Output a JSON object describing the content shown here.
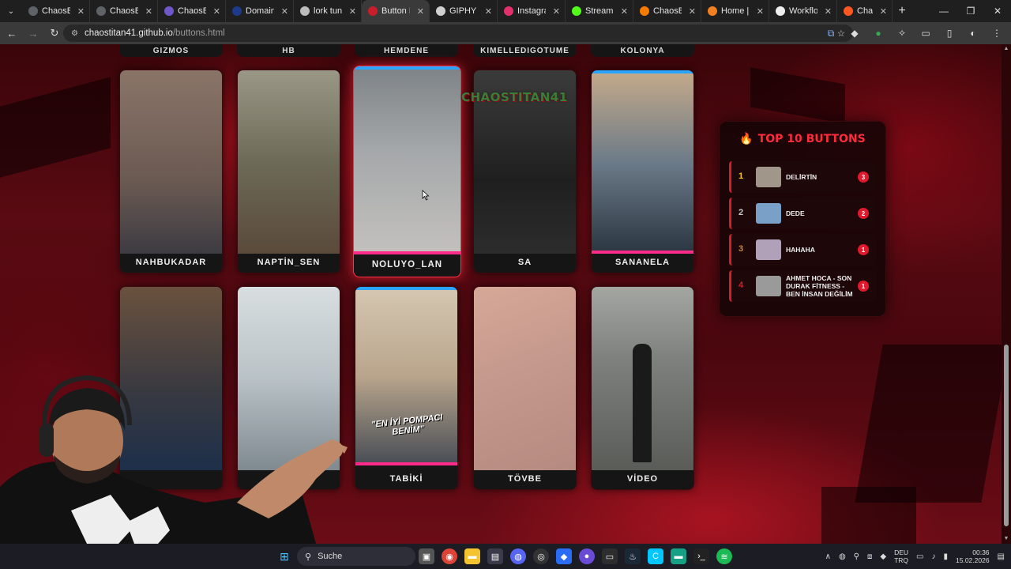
{
  "browser": {
    "tabs": [
      {
        "title": "ChaosBOT",
        "color": "#5f6368"
      },
      {
        "title": "ChaosBOT",
        "color": "#5f6368"
      },
      {
        "title": "ChaosBOT",
        "color": "#6e57c8"
      },
      {
        "title": "Domains -",
        "color": "#1e3a8a"
      },
      {
        "title": "lork tunne",
        "color": "#bdbdbd"
      },
      {
        "title": "Button Pa",
        "color": "#c81e2b"
      },
      {
        "title": "GIPHY - Be",
        "color": "#cfcfcf"
      },
      {
        "title": "Instagram",
        "color": "#e1306c"
      },
      {
        "title": "Stream - K",
        "color": "#53fc18"
      },
      {
        "title": "ChaosBot",
        "color": "#f57c00"
      },
      {
        "title": "Home | Cl",
        "color": "#f38020"
      },
      {
        "title": "Workflow",
        "color": "#eeeeee"
      },
      {
        "title": "ChaosTita",
        "color": "#ff5722"
      }
    ],
    "active_tab": 5,
    "url_host": "chaostitan41.github.io",
    "url_path": "/buttons.html"
  },
  "top_row_labels": [
    "GIZMOS",
    "HB",
    "HEMDENE",
    "KIMELLEDIGOTUME",
    "KOLONYA"
  ],
  "cards_row1": [
    {
      "label": "NAHBUKADAR",
      "bg": "#8a7468"
    },
    {
      "label": "NAPTİN_SEN",
      "bg": "#7d7a66"
    },
    {
      "label": "NOLUYO_LAN",
      "bg": "#9aa0a4"
    },
    {
      "label": "SA",
      "bg": "#2a2a2a"
    },
    {
      "label": "SANANELA",
      "bg": "#6b7a88"
    }
  ],
  "cards_row2": [
    {
      "label": "",
      "bg": "#5b4636"
    },
    {
      "label": "",
      "bg": "#b9c2c6"
    },
    {
      "label": "TABİKİ",
      "bg": "#c9b9a2"
    },
    {
      "label": "TÖVBE",
      "bg": "#c79a8e"
    },
    {
      "label": "VİDEO",
      "bg": "#8d9190"
    }
  ],
  "overlay": {
    "text": "CHAOSTITAN41"
  },
  "thumb_text": {
    "tabiki": "\"EN İYİ POMPACI BENİM\""
  },
  "top10": {
    "title": "TOP 10 BUTTONS",
    "items": [
      {
        "rank": "1",
        "name": "DELİRTİN",
        "count": "3",
        "rank_color": "#f5c518",
        "thumb": "#a0968a"
      },
      {
        "rank": "2",
        "name": "DEDE",
        "count": "2",
        "rank_color": "#c8c8c8",
        "thumb": "#7aa0c8"
      },
      {
        "rank": "3",
        "name": "HAHAHA",
        "count": "1",
        "rank_color": "#c88a3a",
        "thumb": "#b0a0b8"
      },
      {
        "rank": "4",
        "name": "AHMET HOCA - SON DURAK FİTNESS - BEN İNSAN DEĞİLİM",
        "count": "1",
        "rank_color": "#d41d2d",
        "thumb": "#9a9a9a"
      }
    ]
  },
  "taskbar": {
    "search_label": "Suche",
    "lang_top": "DEU",
    "lang_bottom": "TRQ",
    "time": "00:36",
    "date": "15.02.2026"
  }
}
